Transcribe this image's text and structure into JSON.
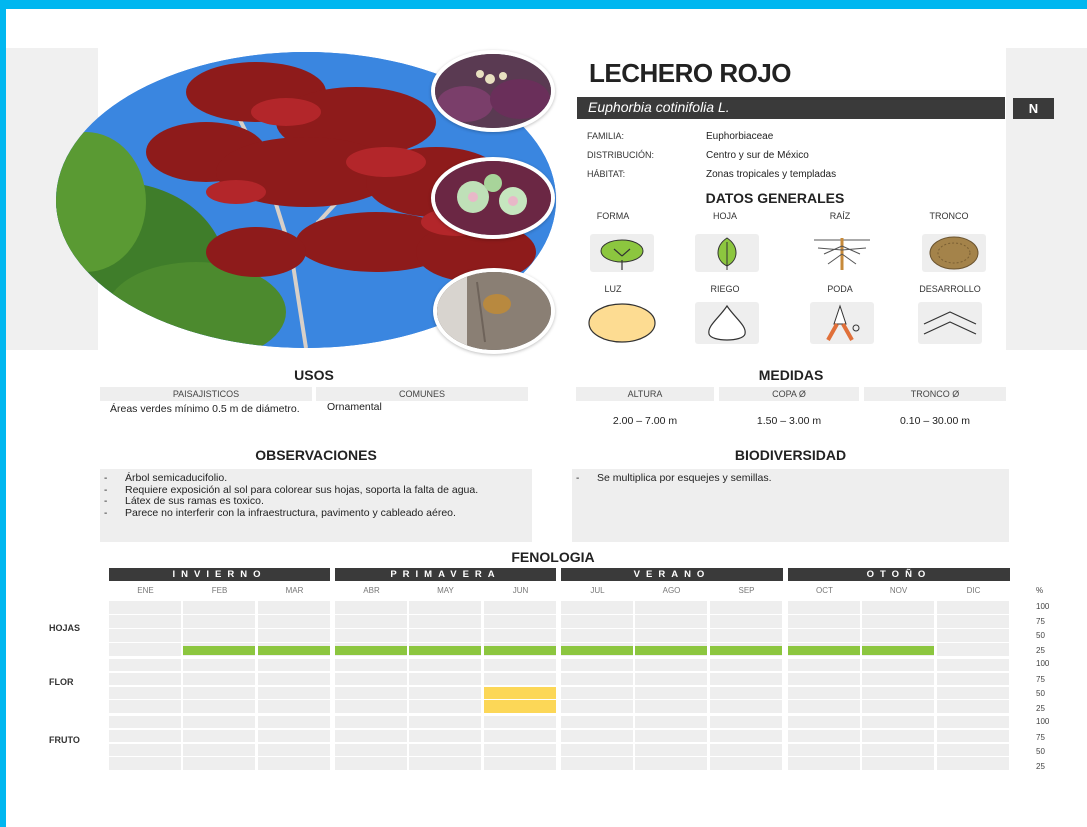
{
  "plant": {
    "common_name": "LECHERO ROJO",
    "scientific_name": "Euphorbia cotinifolia L.",
    "badge": "N"
  },
  "info": [
    {
      "label": "FAMILIA:",
      "value": "Euphorbiaceae"
    },
    {
      "label": "DISTRIBUCIÓN:",
      "value": "Centro y sur de México"
    },
    {
      "label": "HÁBITAT:",
      "value": "Zonas tropicales y templadas"
    }
  ],
  "datos_generales": {
    "title": "DATOS GENERALES",
    "row1": [
      {
        "label": "FORMA",
        "icon": "tree-shape-icon"
      },
      {
        "label": "HOJA",
        "icon": "leaf-icon"
      },
      {
        "label": "RAÍZ",
        "icon": "root-icon"
      },
      {
        "label": "TRONCO",
        "icon": "trunk-texture-icon"
      }
    ],
    "row2": [
      {
        "label": "LUZ",
        "icon": "sun-circle-icon"
      },
      {
        "label": "RIEGO",
        "icon": "water-drop-icon"
      },
      {
        "label": "PODA",
        "icon": "pruning-shears-icon"
      },
      {
        "label": "DESARROLLO",
        "icon": "growth-chevrons-icon"
      }
    ]
  },
  "usos": {
    "title": "USOS",
    "col1_header": "PAISAJISTICOS",
    "col1_text": "Áreas verdes mínimo 0.5 m de diámetro.",
    "col2_header": "COMUNES",
    "col2_text": "Ornamental"
  },
  "medidas": {
    "title": "MEDIDAS",
    "items": [
      {
        "header": "ALTURA",
        "value": "2.00 – 7.00 m"
      },
      {
        "header": "COPA Ø",
        "value": "1.50 – 3.00 m"
      },
      {
        "header": "TRONCO Ø",
        "value": "0.10 – 30.00 m"
      }
    ]
  },
  "observaciones": {
    "title": "OBSERVACIONES",
    "items": [
      "Árbol semicaducifolio.",
      "Requiere exposición al sol para colorear sus hojas, soporta la falta de agua.",
      "Látex de sus ramas es toxico.",
      "Parece no interferir con la infraestructura, pavimento y cableado aéreo."
    ]
  },
  "biodiversidad": {
    "title": "BIODIVERSIDAD",
    "items": [
      "Se multiplica por esquejes y semillas."
    ]
  },
  "fenologia": {
    "title": "FENOLOGIA",
    "seasons": [
      "INVIERNO",
      "PRIMAVERA",
      "VERANO",
      "OTOÑO"
    ],
    "months": [
      "ENE",
      "FEB",
      "MAR",
      "ABR",
      "MAY",
      "JUN",
      "JUL",
      "AGO",
      "SEP",
      "OCT",
      "NOV",
      "DIC"
    ],
    "percent_header": "%",
    "scale": [
      "100",
      "75",
      "50",
      "25"
    ],
    "rows": [
      {
        "label": "HOJAS",
        "color": "#8cc63f",
        "levels_pct": [
          0,
          25,
          25,
          25,
          25,
          25,
          25,
          25,
          25,
          25,
          25,
          0
        ]
      },
      {
        "label": "FLOR",
        "color": "#fcd757",
        "levels_pct": [
          0,
          0,
          0,
          0,
          0,
          50,
          0,
          0,
          0,
          0,
          0,
          0
        ]
      },
      {
        "label": "FRUTO",
        "color": "#c9c9c9",
        "levels_pct": [
          0,
          0,
          0,
          0,
          0,
          0,
          0,
          0,
          0,
          0,
          0,
          0
        ]
      }
    ]
  },
  "colors": {
    "frame": "#00b7f0",
    "dark_bar": "#3a3a3a",
    "light_gray": "#eeeeee",
    "hojas_green": "#8cc63f",
    "flor_yellow": "#fcd757"
  }
}
